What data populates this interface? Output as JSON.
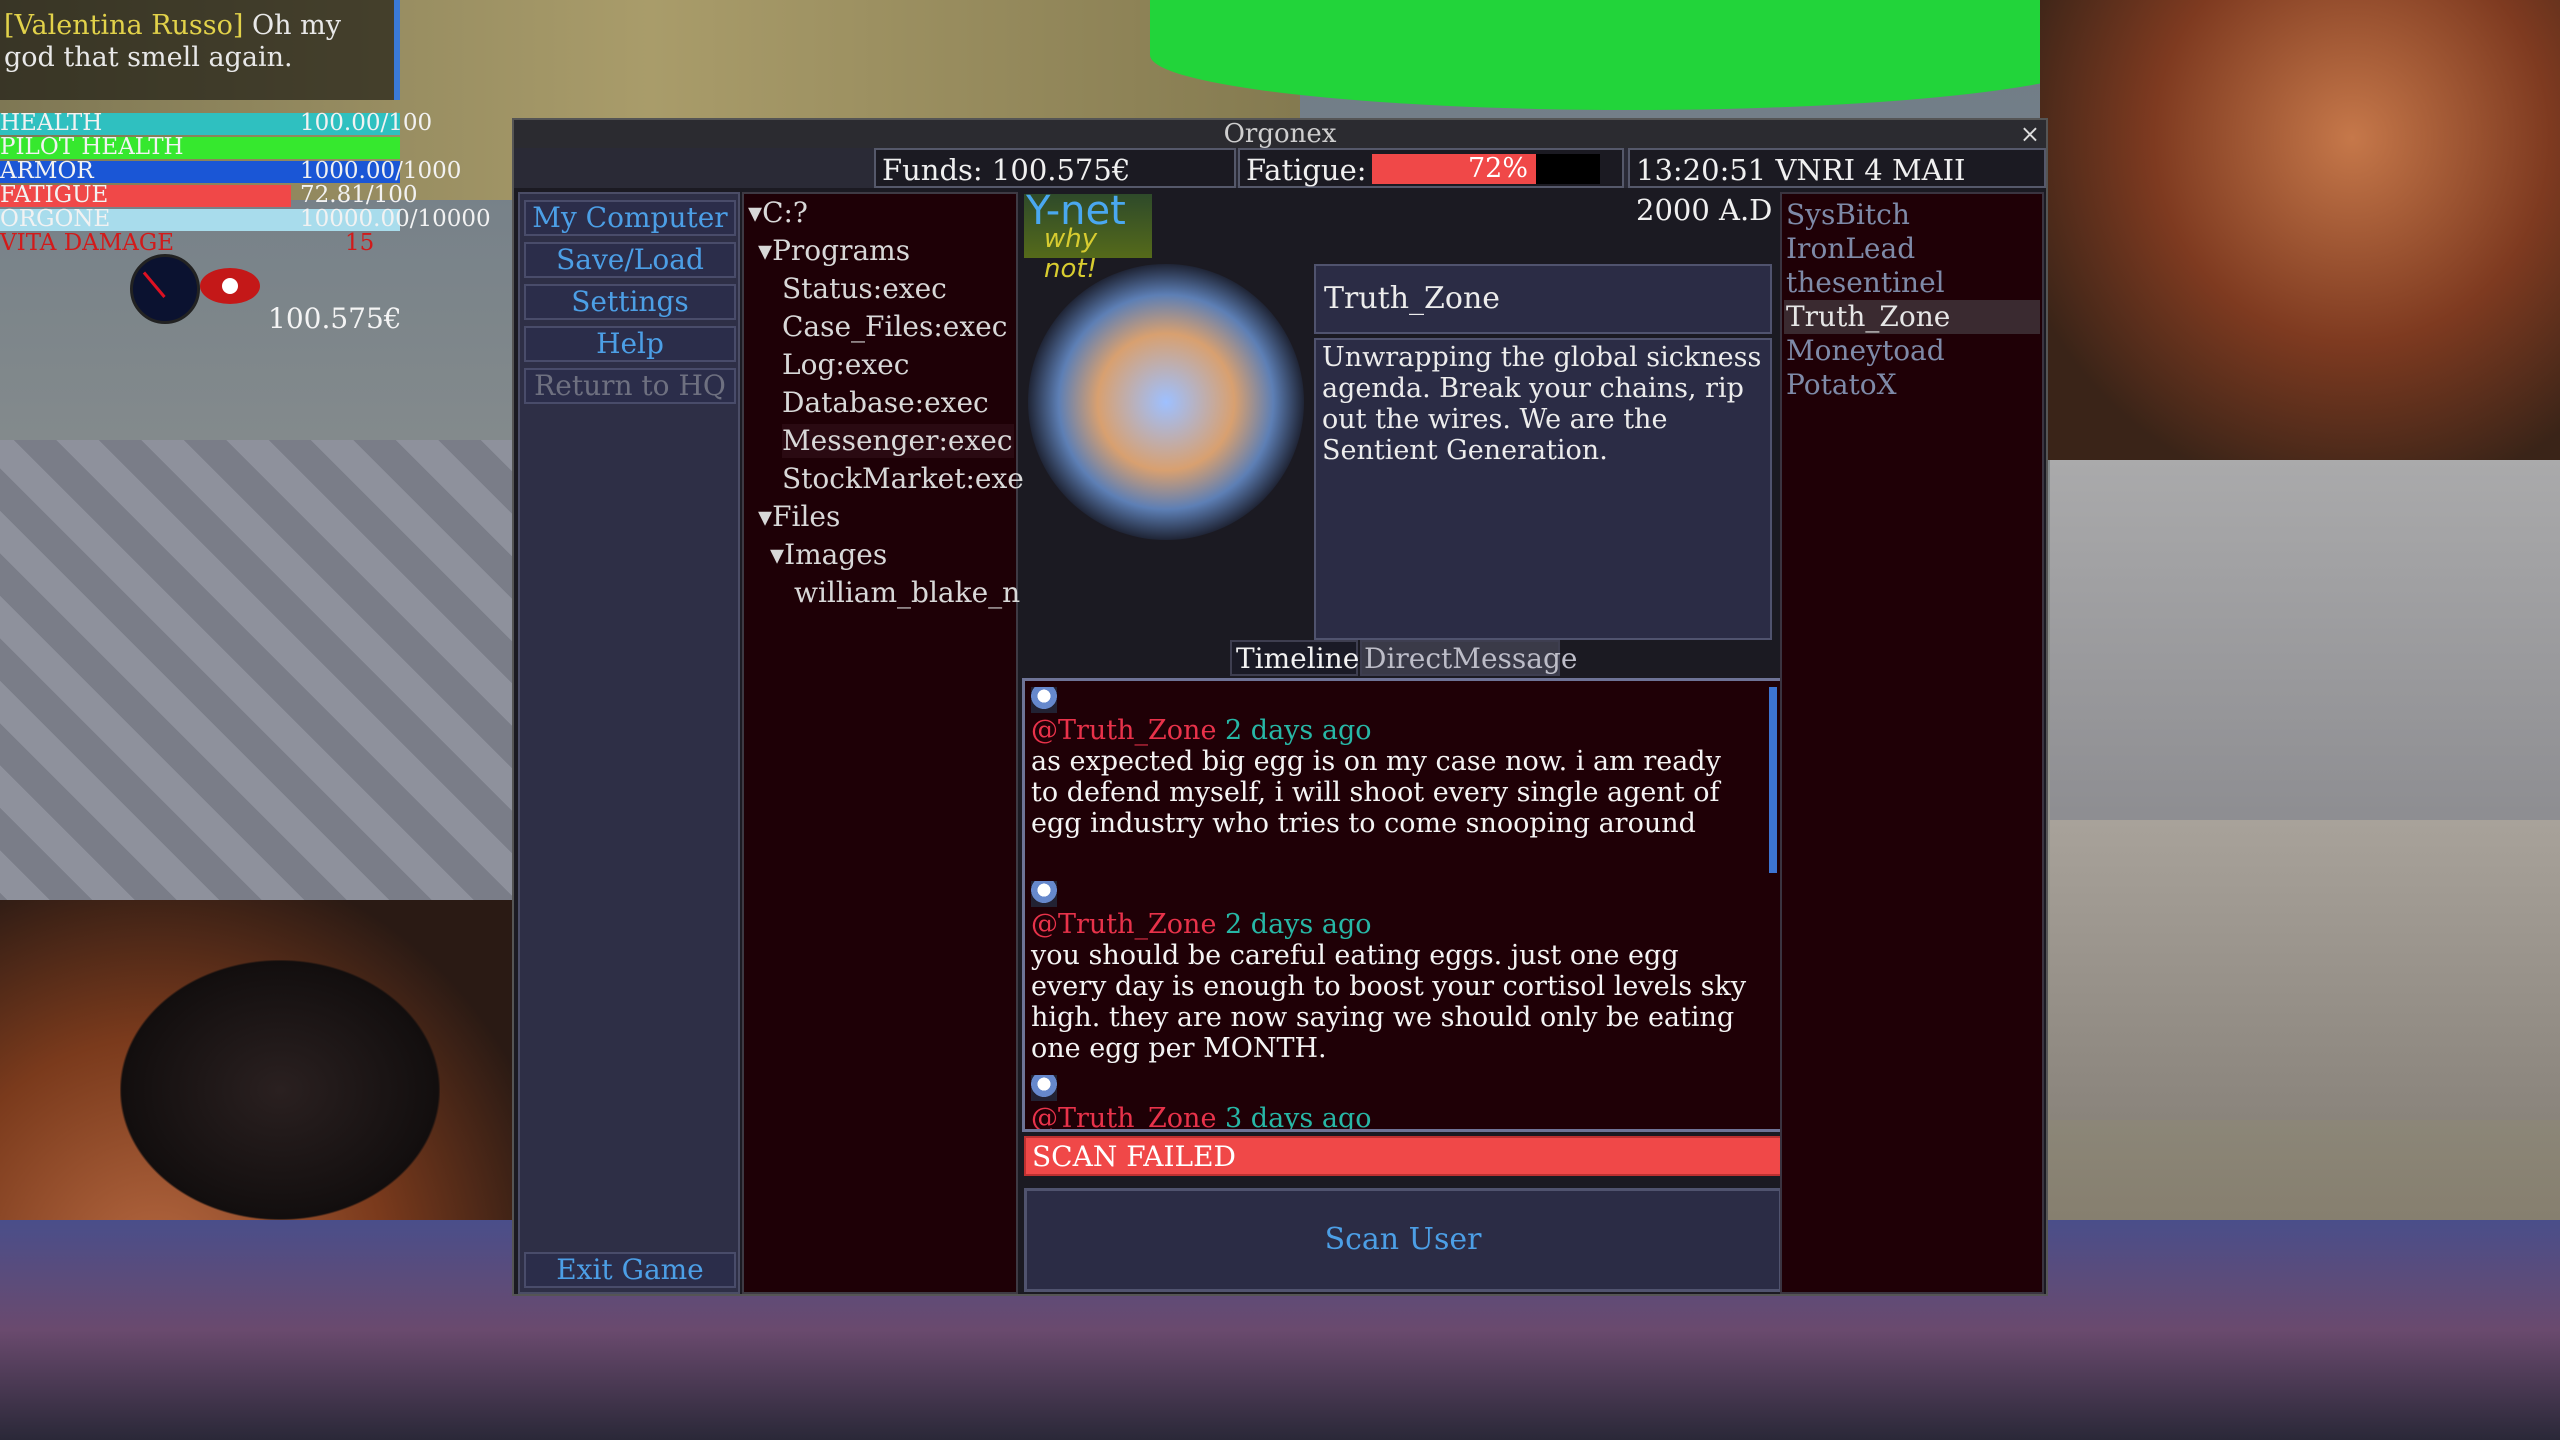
{
  "hud": {
    "chat_who": "[Valentina Russo]",
    "chat_msg": "Oh my god that smell again.",
    "stats": [
      {
        "label": "HEALTH",
        "value": "100.00/100",
        "fraction": 1.0,
        "color": "#2fc0c0"
      },
      {
        "label": "PILOT HEALTH",
        "value": "",
        "fraction": 1.0,
        "color": "#36e82e"
      },
      {
        "label": "ARMOR",
        "value": "1000.00/1000",
        "fraction": 1.0,
        "color": "#1a56d6"
      },
      {
        "label": "FATIGUE",
        "value": "72.81/100",
        "fraction": 0.728,
        "color": "#f04848"
      },
      {
        "label": "ORGONE",
        "value": "10000.00/10000",
        "fraction": 1.0,
        "color": "#a8dcec"
      },
      {
        "label": "VITA DAMAGE",
        "value": "15",
        "fraction": 0.0,
        "color": "#c41818"
      }
    ],
    "funds": "100.575€"
  },
  "window": {
    "title": "Orgonex",
    "close_glyph": "×",
    "funds": "Funds: 100.575€",
    "fatigue_label": "Fatigue:",
    "fatigue_value": "72%",
    "fatigue_fraction": 0.72,
    "datetime": "13:20:51 VNRI 4 MAII 2000 A.D"
  },
  "menu": {
    "items": [
      "My Computer",
      "Save/Load",
      "Settings",
      "Help",
      "Return to HQ"
    ],
    "exit": "Exit Game"
  },
  "tree": {
    "root": "C:?",
    "programs": "Programs",
    "program_items": [
      "Status:exec",
      "Case_Files:exec",
      "Log:exec",
      "Database:exec",
      "Messenger:exec",
      "StockMarket:exe"
    ],
    "files": "Files",
    "images": "Images",
    "image_items": [
      "william_blake_n"
    ]
  },
  "ynet": {
    "logo_main": "Y-net",
    "logo_sub": "why not!",
    "username": "Truth_Zone",
    "bio": "Unwrapping the global sickness agenda. Break your chains, rip out the wires. We are the Sentient Generation.",
    "tabs": [
      "Timeline",
      "DirectMessage"
    ],
    "posts": [
      {
        "handle": "@Truth_Zone",
        "time": "2 days ago",
        "text": "as expected big egg is on my case now. i am ready to defend myself, i will shoot every single agent of egg industry who tries to come snooping around"
      },
      {
        "handle": "@Truth_Zone",
        "time": "2 days ago",
        "text": "you should be careful eating eggs. just one egg every day is enough to boost your cortisol levels sky high. they are now saying we should only be eating one egg per MONTH."
      },
      {
        "handle": "@Truth_Zone",
        "time": "3 days ago",
        "text": ""
      }
    ],
    "scan_status": "SCAN FAILED",
    "scan_button": "Scan User"
  },
  "users": {
    "items": [
      "SysBitch",
      "IronLead",
      "thesentinel",
      "Truth_Zone",
      "Moneytoad",
      "PotatoX"
    ],
    "selected": 3
  }
}
